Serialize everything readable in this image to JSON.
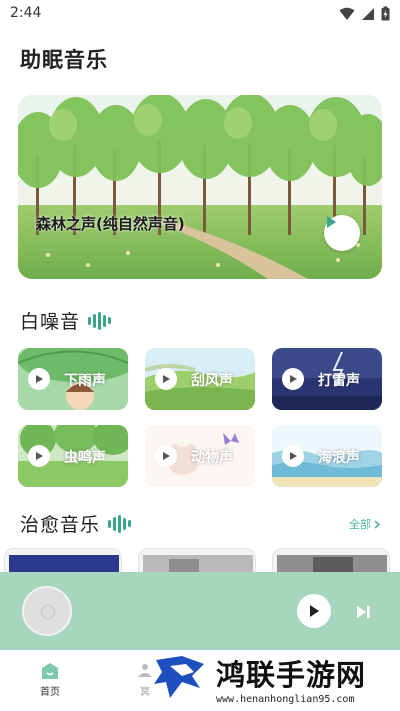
{
  "status": {
    "time": "2:44"
  },
  "page": {
    "title": "助眠音乐"
  },
  "hero": {
    "title": "森林之声(纯自然声音)"
  },
  "white_noise": {
    "title": "白噪音",
    "items": [
      {
        "label": "下雨声",
        "icon": "play-icon"
      },
      {
        "label": "刮风声",
        "icon": "play-icon"
      },
      {
        "label": "打雷声",
        "icon": "play-icon"
      },
      {
        "label": "虫鸣声",
        "icon": "play-icon"
      },
      {
        "label": "动物声",
        "icon": "play-icon"
      },
      {
        "label": "海浪声",
        "icon": "play-icon"
      }
    ]
  },
  "healing": {
    "title": "治愈音乐",
    "see_all": "全部"
  },
  "bottom_nav": {
    "home_label": "首页",
    "second_label": "冥"
  },
  "watermark": {
    "title": "鸿联手游网",
    "url": "www.henanhonglian95.com"
  },
  "colors": {
    "accent": "#3aa58b",
    "player_bg": "#a7d6bf"
  }
}
